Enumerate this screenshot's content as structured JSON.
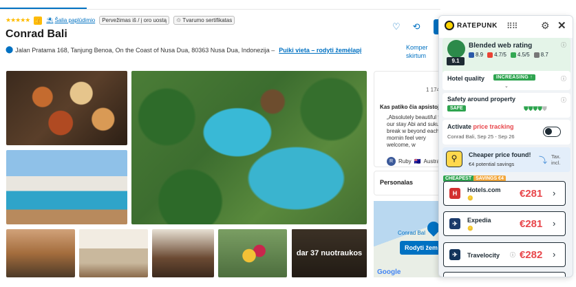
{
  "badges": {
    "stars": "★★★★★",
    "thumb": "👍",
    "beach": "Šalia paplūdimio",
    "transfer": "Pervežimas iš / į oro uostą",
    "sustain": "Tvarumo sertifikatas"
  },
  "hotel": {
    "name": "Conrad Bali",
    "address": "Jalan Pratama 168, Tanjung Benoa, On the Coast of Nusa Dua, 80363 Nusa Dua, Indonezija –",
    "map_link": "Puiki vieta – rodyti žemėlapį"
  },
  "actions": {
    "heart": "♡",
    "share": "⟲",
    "komper": "Komper",
    "skirtum": "skirtum"
  },
  "photos": {
    "more": "dar 37 nuotraukos"
  },
  "review": {
    "count": "1 174",
    "heading": "Kas patiko čia apsistojus",
    "text": "„Absolutely beautiful fault our stay Abi and suku break w beyond each mornin feel very welcome, w",
    "reviewer": "Ruby",
    "reviewer_initial": "R",
    "country": "Austra"
  },
  "personalas": "Personalas",
  "map": {
    "label": "Conrad Bal",
    "button": "Rodyti žem",
    "google": "Google"
  },
  "ratepunk": {
    "brand": "RATEPUNK",
    "grid_icon": "⠿⠿",
    "gear_icon": "⚙",
    "close_icon": "✕",
    "rating_title": "Blended web rating",
    "score": "9.1",
    "sources": [
      {
        "value": "8.9",
        "color": "#2b5aa8"
      },
      {
        "value": "4.7/5",
        "color": "#ea4335"
      },
      {
        "value": "4.5/5",
        "color": "#34a853"
      },
      {
        "value": "8.7",
        "color": "#777777"
      }
    ],
    "hotel_quality": "Hotel quality",
    "quality_badge": "INCREASING",
    "safety_title": "Safety around property",
    "safety_badge": "SAFE",
    "shields": "⛊⛊⛊⛊",
    "shield_empty": "⛊",
    "track_prefix": "Activate ",
    "track_accent": "price tracking",
    "track_sub": "Conrad Bali, Sep 25 - Sep 26",
    "cheaper_title": "Cheaper price found!",
    "cheaper_sub": "€4  potential savings",
    "tax_line1": "Tax.",
    "tax_line2": "incl.",
    "badge_cheapest": "CHEAPEST",
    "badge_savings": "SAVINGS €4",
    "offers": [
      {
        "name": "Hotels.com",
        "price": "€281",
        "color": "#d32f2f",
        "glyph": "H"
      },
      {
        "name": "Expedia",
        "price": "€281",
        "color": "#1b3a6b",
        "glyph": "✈"
      },
      {
        "name": "Travelocity",
        "price": "€282",
        "color": "#13345b",
        "glyph": "✈"
      }
    ],
    "accent_color": "#e8464b",
    "green_color": "#2ea44f"
  }
}
